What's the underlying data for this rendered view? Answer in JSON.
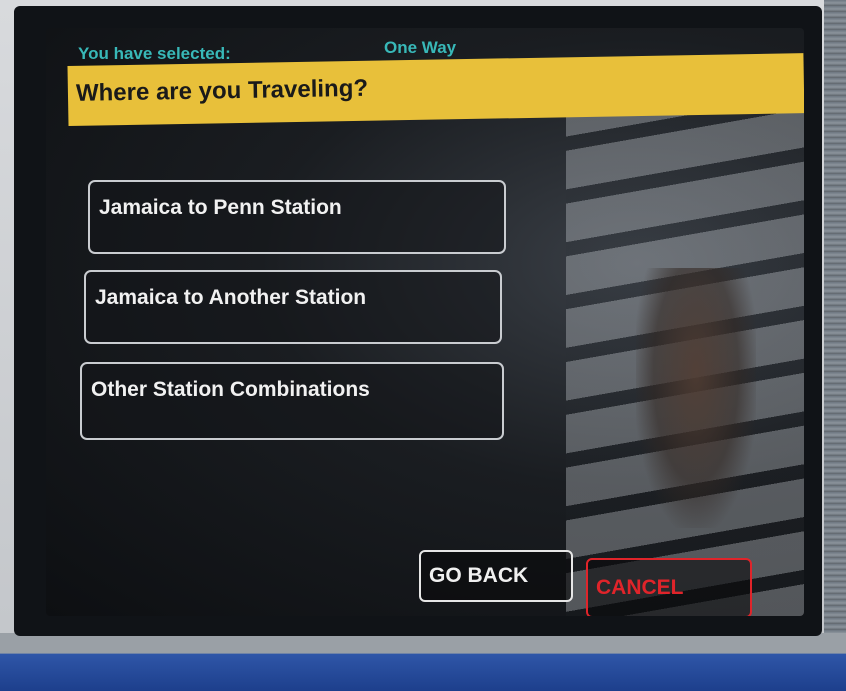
{
  "header": {
    "selected_label": "You have selected:",
    "selected_value": "One Way"
  },
  "banner": {
    "title": "Where are you Traveling?"
  },
  "options": [
    {
      "label": "Jamaica to Penn Station"
    },
    {
      "label": "Jamaica to Another Station"
    },
    {
      "label": "Other Station Combinations"
    }
  ],
  "nav": {
    "go_back_label": "GO BACK",
    "cancel_label": "CANCEL"
  },
  "colors": {
    "banner": "#e8c03a",
    "selected_text": "#38b8b8",
    "cancel": "#e0242a"
  }
}
